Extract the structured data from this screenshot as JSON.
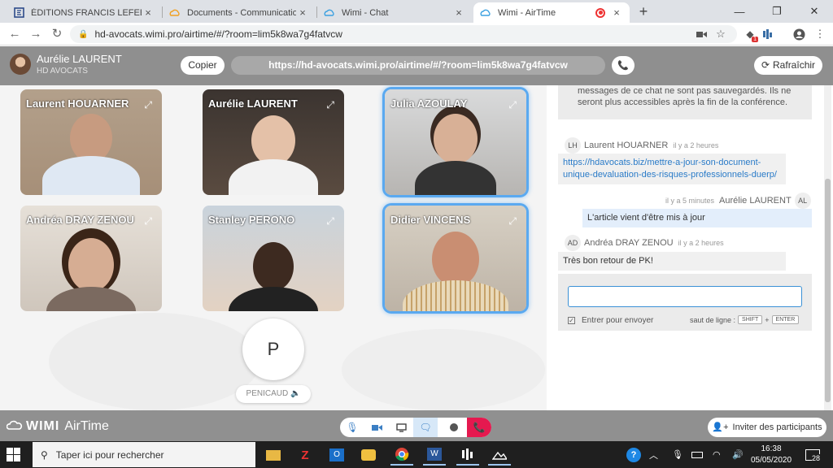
{
  "browser": {
    "tabs": [
      {
        "label": "ÉDITIONS FRANCIS LEFEBVRE - [F",
        "close": "×",
        "icon": "efl-icon"
      },
      {
        "label": "Documents - Communication - H",
        "close": "×",
        "icon": "wimi-icon"
      },
      {
        "label": "Wimi - Chat",
        "close": "×",
        "icon": "wimi-icon"
      },
      {
        "label": "Wimi - AirTime",
        "close": "×",
        "icon": "wimi-icon",
        "recording": true
      }
    ],
    "new_tab": "+",
    "window_controls": {
      "minimize": "—",
      "restore": "❐",
      "close": "✕"
    },
    "url": "hd-avocats.wimi.pro/airtime/#/?room=lim5k8wa7g4fatvcw",
    "extension_badge": "1"
  },
  "header": {
    "user_name": "Aurélie LAURENT",
    "company": "HD AVOCATS",
    "copy_label": "Copier",
    "room_url": "https://hd-avocats.wimi.pro/airtime/#/?room=lim5k8wa7g4fatvcw",
    "refresh_label": "Rafraîchir"
  },
  "participants": [
    {
      "name": "Laurent HOUARNER",
      "speaking": false
    },
    {
      "name": "Aurélie LAURENT",
      "speaking": false
    },
    {
      "name": "Julia AZOULAY",
      "speaking": true
    },
    {
      "name": "Andréa DRAY ZENOU",
      "speaking": false
    },
    {
      "name": "Stanley PERONO",
      "speaking": false
    },
    {
      "name": "Didier VINCENS",
      "speaking": true
    }
  ],
  "audio_participant": {
    "initial": "P",
    "name": "PENICAUD"
  },
  "chat": {
    "notice": "messages de ce chat ne sont pas sauvegardés. Ils ne seront plus accessibles après la fin de la conférence.",
    "messages": [
      {
        "initials": "LH",
        "author": "Laurent HOUARNER",
        "time": "il y a 2 heures",
        "text": "https://hdavocats.biz/mettre-a-jour-son-document-unique-devaluation-des-risques-professionnels-duerp/",
        "link": true
      },
      {
        "initials": "AL",
        "author": "Aurélie LAURENT",
        "time": "il y a 5 minutes",
        "text": "L'article vient d'être mis à jour",
        "mine": true
      },
      {
        "initials": "AD",
        "author": "Andréa DRAY ZENOU",
        "time": "il y a 2 heures",
        "text": "Très bon retour de PK!"
      }
    ],
    "input_value": "",
    "enter_to_send": "Entrer pour envoyer",
    "line_break_label": "saut de ligne :",
    "key_shift": "SHIFT",
    "key_plus": "+",
    "key_enter": "ENTER"
  },
  "footer": {
    "brand": "WIMI",
    "product": "AirTime",
    "invite_label": "Inviter des participants"
  },
  "taskbar": {
    "search_placeholder": "Taper ici pour rechercher",
    "time": "16:38",
    "date": "05/05/2020",
    "notifications": "28"
  },
  "colors": {
    "speaking_border": "#5aa9f0",
    "hangup": "#e5194f",
    "link": "#2a7bc8"
  }
}
